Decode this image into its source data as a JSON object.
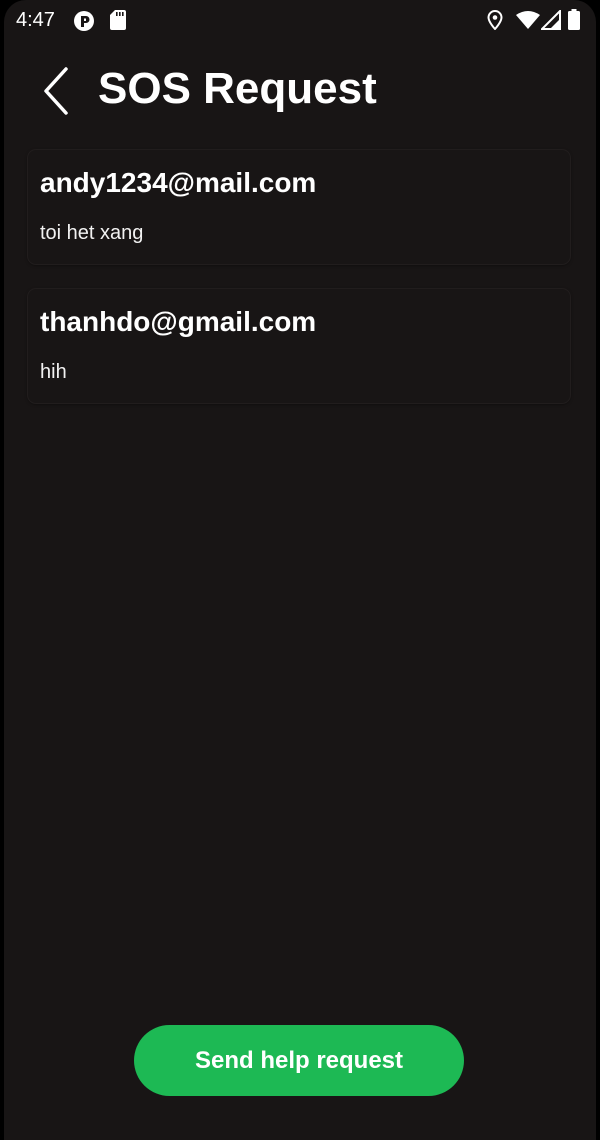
{
  "status_bar": {
    "time": "4:47",
    "icons": [
      "app-notification-icon",
      "sd-card-icon",
      "location-icon",
      "wifi-icon",
      "cellular-signal-icon",
      "battery-icon"
    ]
  },
  "header": {
    "back_icon": "chevron-left-icon",
    "title": "SOS Request"
  },
  "requests": [
    {
      "email": "andy1234@mail.com",
      "message": "toi het xang"
    },
    {
      "email": "thanhdo@gmail.com",
      "message": "hih"
    }
  ],
  "footer": {
    "send_button_label": "Send help request"
  },
  "colors": {
    "background": "#181515",
    "accent": "#1db954",
    "text": "#ffffff"
  }
}
